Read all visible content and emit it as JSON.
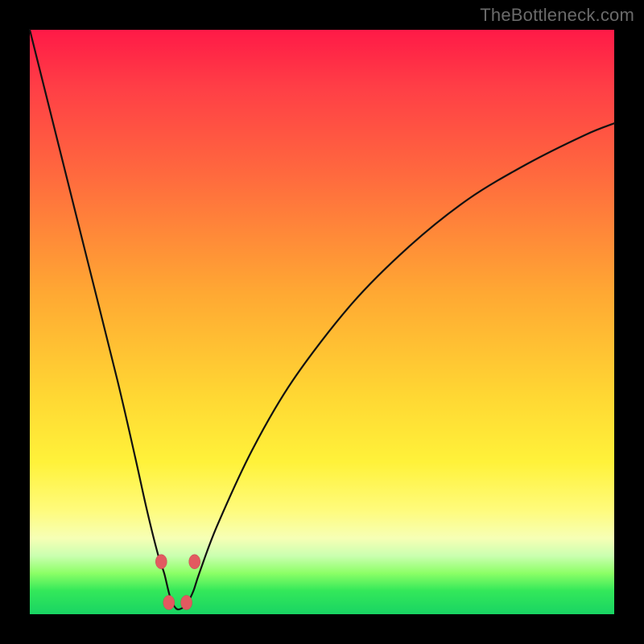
{
  "watermark": "TheBottleneck.com",
  "colors": {
    "frame": "#000000",
    "curve_stroke": "#111111",
    "marker_fill": "#e25a60",
    "marker_stroke": "#c24a50",
    "gradient_stops": [
      "#ff1a47",
      "#ff3f46",
      "#ff6a3e",
      "#ffa833",
      "#ffd833",
      "#fff23a",
      "#fffb7a",
      "#f6ffb5",
      "#caffb0",
      "#8cff66",
      "#33e85a",
      "#19d463"
    ]
  },
  "chart_data": {
    "type": "line",
    "title": "",
    "xlabel": "",
    "ylabel": "",
    "xlim": [
      0,
      100
    ],
    "ylim": [
      0,
      100
    ],
    "grid": false,
    "legend": false,
    "series": [
      {
        "name": "bottleneck-curve",
        "x": [
          0,
          5,
          10,
          15,
          18,
          20,
          22,
          23,
          24,
          25,
          26,
          27,
          28,
          29,
          32,
          38,
          45,
          55,
          65,
          75,
          85,
          95,
          100
        ],
        "values": [
          100,
          80,
          60,
          40,
          27,
          18,
          10,
          7,
          3,
          1,
          1,
          2,
          4,
          7,
          15,
          28,
          40,
          53,
          63,
          71,
          77,
          82,
          84
        ]
      }
    ],
    "markers": [
      {
        "x": 22.5,
        "y": 9
      },
      {
        "x": 23.8,
        "y": 2
      },
      {
        "x": 26.8,
        "y": 2
      },
      {
        "x": 28.2,
        "y": 9
      }
    ],
    "annotations": []
  }
}
